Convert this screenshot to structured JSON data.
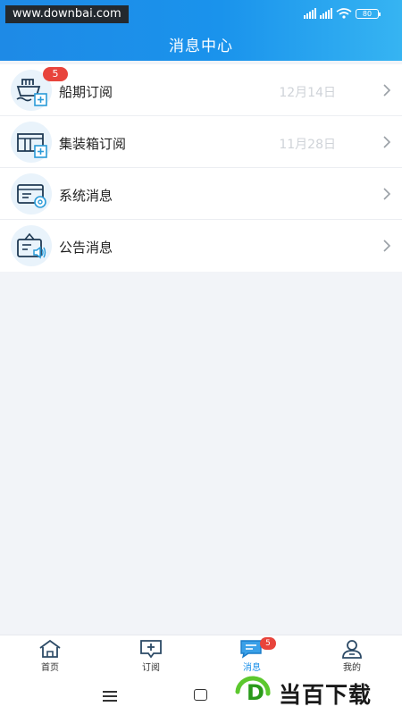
{
  "watermark_url": "www.downbai.com",
  "status_bar": {
    "signal_labels": [
      "HD",
      "HD"
    ],
    "battery": "80"
  },
  "header": {
    "title": "消息中心"
  },
  "messages": [
    {
      "label": "船期订阅",
      "date": "12月14日",
      "badge": "5",
      "icon": "ship-icon"
    },
    {
      "label": "集装箱订阅",
      "date": "11月28日",
      "badge": "",
      "icon": "container-icon"
    },
    {
      "label": "系统消息",
      "date": "",
      "badge": "",
      "icon": "system-message-icon"
    },
    {
      "label": "公告消息",
      "date": "",
      "badge": "",
      "icon": "announcement-icon"
    }
  ],
  "tabbar": {
    "items": [
      {
        "label": "首页",
        "icon": "home-icon"
      },
      {
        "label": "订阅",
        "icon": "subscribe-icon"
      },
      {
        "label": "消息",
        "icon": "message-icon",
        "badge": "5",
        "active": true
      },
      {
        "label": "我的",
        "icon": "user-icon"
      }
    ]
  },
  "brand_watermark": {
    "text": "当百下载",
    "logo_letter": "D"
  },
  "colors": {
    "primary": "#1a8fe8",
    "badge": "#e8443c",
    "icon_stroke": "#1f3a54",
    "icon_accent": "#2a9bd8"
  }
}
